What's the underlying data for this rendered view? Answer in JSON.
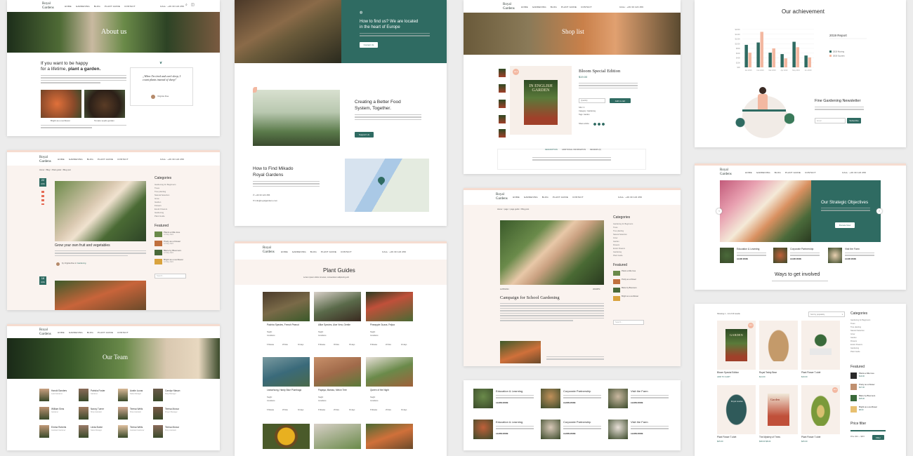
{
  "brand": {
    "name": "Royal Gardens",
    "logo_line1": "Royal",
    "logo_line2": "Gardens",
    "tagline": "Est. 2019"
  },
  "nav": [
    "HOME",
    "GARDENING",
    "BLOG",
    "PLANT GUIDE",
    "CONTACT"
  ],
  "header": {
    "phone": "CALL: +49 30 123 456",
    "topbar_left": "Contact Support",
    "topbar_mid": "FAQ",
    "topbar_right": "Subscribe",
    "topbar_right2": "Newsletter"
  },
  "colors": {
    "teal": "#2f6b62",
    "peach": "#f3b8a1",
    "topbar": "#f6dcd0"
  },
  "about": {
    "hero_title": "About us",
    "heading_1": "If you want to be happy",
    "heading_2": "for a lifetime,",
    "heading_bold": "plant a garden.",
    "quote": "„When I'm tired and can't sleep, I count plants instead of sheep\"",
    "quote_author": "Virginia Doe",
    "caption_1": "Bright as a sunflower",
    "caption_2": "Tomato seeds garden"
  },
  "blog_post": {
    "day": "22",
    "month": "AUG",
    "day2": "18",
    "month2": "AUG",
    "breadcrumb": "Home > Blog > Plant guide > Blog post",
    "title": "Grow your own fruit and vegetables",
    "author": "by Virginia Doe",
    "category": "Gardening"
  },
  "categories": {
    "title": "Categories",
    "items": [
      "Gardening for Beginners",
      "Trees",
      "Tree planting",
      "Natural Selection",
      "Grow",
      "Garden",
      "Flowers",
      "Exotic Flowers",
      "Gardening",
      "Plant Guide"
    ]
  },
  "featured": {
    "title": "Featured",
    "items": [
      {
        "name": "Plants a little love",
        "meta": "12 May 2024"
      },
      {
        "name": "Pretty as a Flower",
        "meta": "12 May 2024"
      },
      {
        "name": "Blaze by Bloomers",
        "meta": "12 May 2024"
      },
      {
        "name": "Bright as a sunflower",
        "meta": "12 May 2024"
      }
    ]
  },
  "search": {
    "placeholder": "Search..."
  },
  "team": {
    "hero_title": "Our Team",
    "members": [
      {
        "name": "Harold Sanders",
        "role": "Lead Gardener"
      },
      {
        "name": "Patricia Foster",
        "role": "Gardener"
      },
      {
        "name": "Austin Lucas",
        "role": "Sales Manager"
      },
      {
        "name": "Carolyn Mason",
        "role": "Shop Manager"
      },
      {
        "name": "William Sims",
        "role": "Gardener"
      },
      {
        "name": "Nancy Turner",
        "role": "Shop Assistant"
      },
      {
        "name": "Teresa Wells",
        "role": "Shop Assistant"
      },
      {
        "name": "Teresa Munoz",
        "role": "Project Manager"
      },
      {
        "name": "Emma Roberts",
        "role": "Assistant Gardener"
      },
      {
        "name": "Linda Burke",
        "role": "Sales Manager"
      },
      {
        "name": "Teresa Wells",
        "role": "Assistant Gardener"
      },
      {
        "name": "Teresa Munoz",
        "role": "Shop Assistant"
      }
    ]
  },
  "contact": {
    "location_title_1": "How to find us? We are located",
    "location_title_2": "in the heart of Europe",
    "button": "Contact Us",
    "food_title_1": "Creating a Better Food",
    "food_title_2": "System, Together.",
    "food_button": "Support Us",
    "find_title_1": "How to Find Mikado",
    "find_title_2": "Royal Gardens",
    "phone": "+49 30 123 456",
    "email": "info@royalgardens.com"
  },
  "plant_guides": {
    "title": "Plant Guides",
    "subtitle": "Lorem ipsum dolor sit amet, consectetur adipiscing elit",
    "items": [
      {
        "name": "Pachira Species, French Peanut",
        "height": "Height:",
        "cond": "Conditions:",
        "likes": "8 Shades",
        "water": "25 Mos",
        "days": "30 days"
      },
      {
        "name": "Alliar Species, Aloe Vera, Gentle",
        "height": "Height:",
        "cond": "Conditions:",
        "likes": "8 Shades",
        "water": "35 Mos",
        "days": "35 days"
      },
      {
        "name": "Pineapple Guava, Feijoa",
        "height": "Height:",
        "cond": "Conditions:",
        "likes": "8 Shades",
        "water": "20 Mos",
        "days": "40 days"
      },
      {
        "name": "Lease/sung, Hardy Blue Plumbago",
        "height": "Height:",
        "cond": "Conditions:",
        "likes": "8 Shades",
        "water": "25 Mos",
        "days": "30 days"
      },
      {
        "name": "Papaya, Mamao, Melon Tree",
        "height": "Height:",
        "cond": "Conditions:",
        "likes": "8 Shades",
        "water": "25 Mos",
        "days": "30 days"
      },
      {
        "name": "Queen of the Night",
        "height": "Height:",
        "cond": "Conditions:",
        "likes": "8 Shades",
        "water": "25 Mos",
        "days": "30 days"
      }
    ]
  },
  "shop": {
    "hero_title": "Shop list",
    "sale": "SALE",
    "book_cover": "IN ENGLISH GARDEN",
    "product_title": "Bloom Special Edition",
    "price": "$19.00",
    "qty_label": "Quantity",
    "add_to_cart": "Add to cart",
    "sku": "SKU: 3",
    "category": "Category: Gardening",
    "tags": "Tags: Garden",
    "share": "Share article:",
    "tabs": [
      "DESCRIPTION",
      "ADDITIONAL INFORMATION",
      "REVIEWS (0)"
    ]
  },
  "campaign": {
    "breadcrumb": "Home > page > page guide > Blog post",
    "title": "Campaign for School Gardening",
    "date_left": "12/05/2024",
    "date_right": "JR/20PM",
    "search_placeholder": "Search..."
  },
  "engagement": [
    {
      "title": "Education & Learning",
      "link": "LEARN MORE"
    },
    {
      "title": "Corporate Partnership",
      "link": "LEARN MORE"
    },
    {
      "title": "Visit the Farm",
      "link": "LEARN MORE"
    },
    {
      "title": "Education & Learning",
      "link": "LEARN MORE"
    },
    {
      "title": "Corporate Partnership",
      "link": "LEARN MORE"
    },
    {
      "title": "Visit the Farm",
      "link": "LEARN MORE"
    }
  ],
  "achievement": {
    "title": "Our achievement",
    "report_title": "2019 Report",
    "legend": [
      "2019 Moving",
      "2019 Scorers"
    ],
    "newsletter_title": "Fine Gardening Newsletter",
    "email_placeholder": "Email",
    "subscribe": "Subscribe"
  },
  "chart_data": {
    "type": "bar",
    "title": "2019 Report",
    "categories": [
      "Jan 2019",
      "Feb 2019",
      "Mar 2019",
      "Apr 2019",
      "May 2019",
      "Jun 2019"
    ],
    "ylim": [
      0,
      160
    ],
    "yticks": [
      "$160K",
      "$140K",
      "$120K",
      "$100K",
      "$80K",
      "$60K",
      "$40K",
      "$20K",
      "$0K"
    ],
    "series": [
      {
        "name": "2019 Moving",
        "color": "#2f6b62",
        "values": [
          95,
          105,
          62,
          56,
          108,
          50
        ]
      },
      {
        "name": "2019 Scorers",
        "color": "#f3b8a1",
        "values": [
          62,
          150,
          80,
          38,
          85,
          42
        ]
      }
    ]
  },
  "strategic": {
    "title": "Our Strategic Objectives",
    "button": "Donate Now",
    "cards": [
      {
        "title": "Education & Learning",
        "link": "LEARN MORE"
      },
      {
        "title": "Corporate Partnership",
        "link": "LEARN MORE"
      },
      {
        "title": "Visit the Farm",
        "link": "LEARN MORE"
      }
    ],
    "ways_title": "Ways to get involved"
  },
  "shop_grid": {
    "showing": "Showing 1 – 12 of 20 results",
    "sort": "Sort by popularity",
    "sale": "SALE",
    "products": [
      {
        "name": "Bloom Special Edition",
        "price": "ADD TO CART"
      },
      {
        "name": "Royal Teddy Bear",
        "price": "$14.00"
      },
      {
        "name": "Plant Flower T-shirt",
        "price": "$19.00"
      },
      {
        "name": "Plant Flower T-shirt",
        "price": "$25.00"
      },
      {
        "name": "The Mystery of Trees",
        "price": "$38.00 $8.00"
      },
      {
        "name": "Plant Flower T-shirt",
        "price": "$25.00"
      }
    ],
    "book_label": "GARDEN",
    "book_label2": "Garden",
    "shirt_label": "Royal Garden",
    "categories_title": "Categories",
    "featured_title": "Featured",
    "featured": [
      {
        "name": "Plants a little love",
        "price": "$19.00"
      },
      {
        "name": "Pretty as a Flower",
        "price": "$27.00"
      },
      {
        "name": "Blaze by Bloomers",
        "price": "$35.00"
      },
      {
        "name": "Bright as a sunflower",
        "price": "$8.00"
      }
    ],
    "price_filter": "Price filter",
    "price_range": "Price: $10 — $315",
    "filter_button": "Filter"
  }
}
